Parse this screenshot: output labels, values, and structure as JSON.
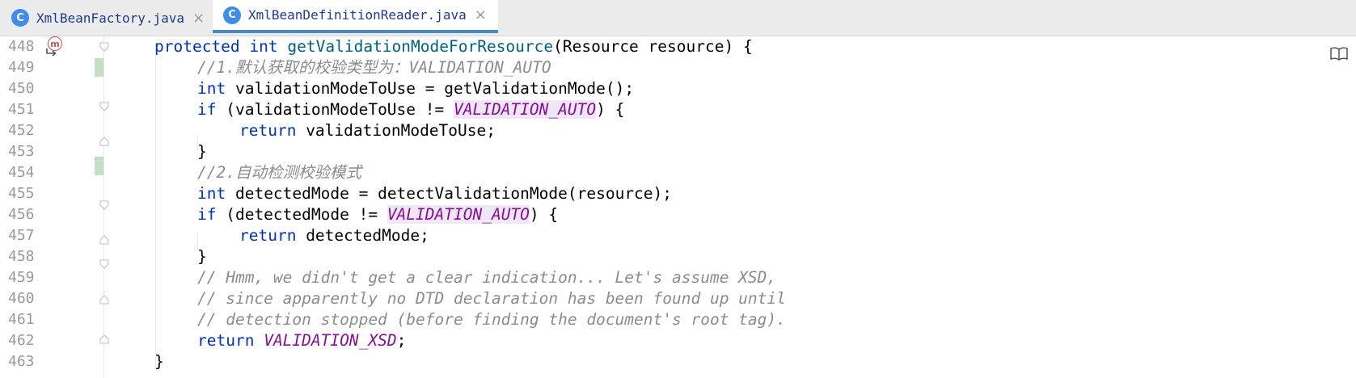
{
  "tabs": [
    {
      "icon": "C",
      "label": "XmlBeanFactory.java",
      "close": "×",
      "active": false
    },
    {
      "icon": "C",
      "label": "XmlBeanDefinitionReader.java",
      "close": "×",
      "active": true
    }
  ],
  "gutter_marker": {
    "label": "m"
  },
  "lines": [
    {
      "number": "448"
    },
    {
      "number": "449"
    },
    {
      "number": "450"
    },
    {
      "number": "451"
    },
    {
      "number": "452"
    },
    {
      "number": "453"
    },
    {
      "number": "454"
    },
    {
      "number": "455"
    },
    {
      "number": "456"
    },
    {
      "number": "457"
    },
    {
      "number": "458"
    },
    {
      "number": "459"
    },
    {
      "number": "460"
    },
    {
      "number": "461"
    },
    {
      "number": "462"
    },
    {
      "number": "463"
    }
  ],
  "code": {
    "l448": {
      "kw1": "protected",
      "kw2": "int",
      "fn": "getValidationModeForResource",
      "rest": "(Resource resource) {"
    },
    "l449": {
      "comment": "//1.默认获取的校验类型为：VALIDATION_AUTO"
    },
    "l450": {
      "kw": "int",
      "rest": " validationModeToUse = getValidationMode();"
    },
    "l451": {
      "kw": "if",
      "pre": " (validationModeToUse != ",
      "const": "VALIDATION_AUTO",
      "post": ") {"
    },
    "l452": {
      "kw": "return",
      "rest": " validationModeToUse;"
    },
    "l453": {
      "text": "}"
    },
    "l454": {
      "comment": "//2.自动检测校验模式"
    },
    "l455": {
      "kw": "int",
      "rest": " detectedMode = detectValidationMode(resource);"
    },
    "l456": {
      "kw": "if",
      "pre": " (detectedMode != ",
      "const": "VALIDATION_AUTO",
      "post": ") {"
    },
    "l457": {
      "kw": "return",
      "rest": " detectedMode;"
    },
    "l458": {
      "text": "}"
    },
    "l459": {
      "comment": "// Hmm, we didn't get a clear indication... Let's assume XSD,"
    },
    "l460": {
      "comment": "// since apparently no DTD declaration has been found up until"
    },
    "l461": {
      "comment": "// detection stopped (before finding the document's root tag)."
    },
    "l462": {
      "kw": "return",
      "const": "VALIDATION_XSD",
      "post": ";"
    },
    "l463": {
      "text": "}"
    }
  },
  "colors": {
    "keyword": "#0033b3",
    "method": "#00627a",
    "comment": "#8c8c8c",
    "constant": "#871094",
    "change": "#c4dfc4",
    "tab_underline": "#4a88c7"
  }
}
